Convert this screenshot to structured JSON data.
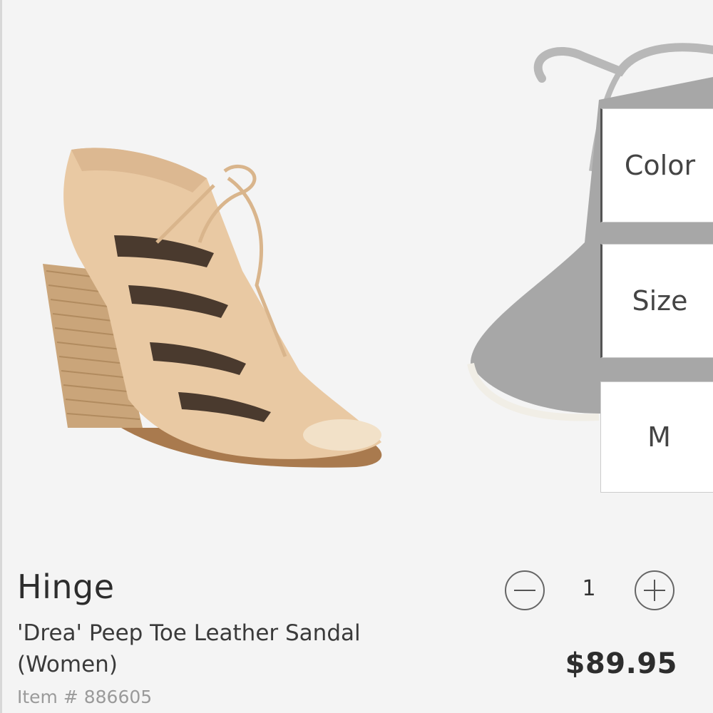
{
  "product": {
    "brand": "Hinge",
    "name": "'Drea' Peep Toe Leather Sandal (Women)",
    "item_number": "Item # 886605",
    "price": "$89.95"
  },
  "options": {
    "color_label": "Color",
    "size_label": "Size",
    "width_label": "M"
  },
  "quantity": {
    "value": "1"
  },
  "icons": {
    "minus": "minus-circle-icon",
    "plus": "plus-circle-icon"
  }
}
